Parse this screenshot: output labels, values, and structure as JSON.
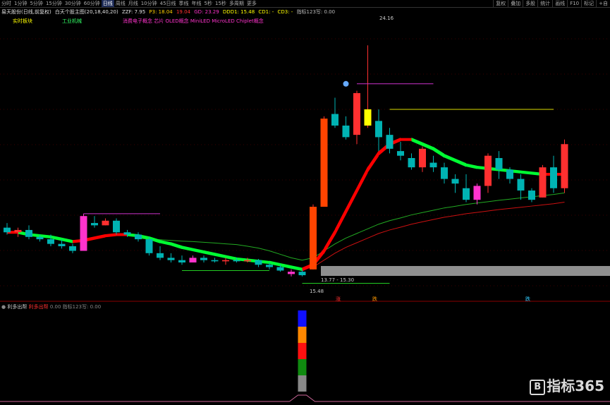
{
  "toolbar": {
    "tabs": [
      "分时",
      "1分钟",
      "5分钟",
      "15分钟",
      "30分钟",
      "60分钟",
      "日线",
      "周线",
      "月线",
      "10分钟",
      "45日线",
      "季线",
      "年线",
      "5秒",
      "15秒",
      "多周期",
      "更多"
    ],
    "active_tab": "日线",
    "right_buttons": [
      "复权",
      "叠加",
      "多股",
      "统计",
      "画线",
      "F10",
      "标记",
      "+自"
    ]
  },
  "info": {
    "stock": "易天股份(日线,前复权)",
    "indicator": "白天个股主图(20,18,40,20)",
    "zzf": "ZZF: 7.95",
    "p3": "P3: 18.04",
    "v1": "19.04",
    "gd": "GD: 23.29",
    "ddd1": "DDD1: 15.48",
    "cd1": "CD1: -",
    "cd3": "CD3: -",
    "zb": "指标123写: 0.00"
  },
  "labels": {
    "strong_sector": "实时板块",
    "industry": "工业机械",
    "concepts": "消费电子概念 芯片 OLED概念 MiniLED MicroLED Chiplet概念",
    "hi_price": "24.16",
    "lo_price": "15.48",
    "range": "13.77 - 15.30",
    "mk1": "涨",
    "mk2": "跌",
    "mk3": "跌"
  },
  "sub": {
    "title": "利多出帮",
    "name": "利多出帮",
    "v1": "0.00",
    "v2": "指标123写: 0.00"
  },
  "watermark": {
    "logo": "B",
    "text": "指标365"
  },
  "colors": {
    "up": "#ff3030",
    "down": "#00b3b3",
    "band_up": "#ff0000",
    "band_dn": "#00ff33",
    "magenta": "#ff33cc",
    "yellow": "#ffff00"
  },
  "chart_data": {
    "type": "candlestick",
    "candles": [
      {
        "o": 16.3,
        "h": 16.5,
        "l": 16.0,
        "c": 16.1
      },
      {
        "o": 16.1,
        "h": 16.3,
        "l": 15.9,
        "c": 16.2
      },
      {
        "o": 16.2,
        "h": 16.4,
        "l": 15.8,
        "c": 15.9
      },
      {
        "o": 15.9,
        "h": 16.0,
        "l": 15.7,
        "c": 15.8
      },
      {
        "o": 15.8,
        "h": 16.0,
        "l": 15.5,
        "c": 15.6
      },
      {
        "o": 15.6,
        "h": 15.8,
        "l": 15.4,
        "c": 15.5
      },
      {
        "o": 15.5,
        "h": 15.6,
        "l": 15.2,
        "c": 15.3
      },
      {
        "o": 15.3,
        "h": 16.9,
        "l": 15.3,
        "c": 16.8,
        "special": "m"
      },
      {
        "o": 16.5,
        "h": 16.8,
        "l": 16.3,
        "c": 16.4
      },
      {
        "o": 16.4,
        "h": 16.7,
        "l": 16.4,
        "c": 16.6
      },
      {
        "o": 16.6,
        "h": 16.7,
        "l": 16.0,
        "c": 16.1
      },
      {
        "o": 16.1,
        "h": 16.2,
        "l": 15.9,
        "c": 16.0
      },
      {
        "o": 16.0,
        "h": 16.1,
        "l": 15.7,
        "c": 15.8
      },
      {
        "o": 15.8,
        "h": 15.9,
        "l": 15.1,
        "c": 15.2
      },
      {
        "o": 15.2,
        "h": 15.5,
        "l": 14.9,
        "c": 15.0
      },
      {
        "o": 15.0,
        "h": 15.2,
        "l": 14.8,
        "c": 14.9
      },
      {
        "o": 14.9,
        "h": 15.1,
        "l": 14.7,
        "c": 14.8
      },
      {
        "o": 14.8,
        "h": 15.1,
        "l": 14.8,
        "c": 15.0,
        "special": "m"
      },
      {
        "o": 15.0,
        "h": 15.1,
        "l": 14.8,
        "c": 14.9
      },
      {
        "o": 14.9,
        "h": 15.0,
        "l": 14.8,
        "c": 14.85
      },
      {
        "o": 14.85,
        "h": 15.0,
        "l": 14.7,
        "c": 14.9
      },
      {
        "o": 14.9,
        "h": 15.0,
        "l": 14.8,
        "c": 14.85
      },
      {
        "o": 14.85,
        "h": 15.0,
        "l": 14.8,
        "c": 14.9
      },
      {
        "o": 14.9,
        "h": 14.95,
        "l": 14.6,
        "c": 14.7
      },
      {
        "o": 14.7,
        "h": 14.8,
        "l": 14.5,
        "c": 14.6
      },
      {
        "o": 14.6,
        "h": 14.7,
        "l": 14.4,
        "c": 14.45
      },
      {
        "o": 14.3,
        "h": 14.5,
        "l": 14.2,
        "c": 14.4,
        "special": "m"
      },
      {
        "o": 14.4,
        "h": 14.5,
        "l": 14.2,
        "c": 14.25
      },
      {
        "o": 14.5,
        "h": 17.3,
        "l": 14.5,
        "c": 17.2
      },
      {
        "o": 17.2,
        "h": 21.1,
        "l": 17.2,
        "c": 21.0
      },
      {
        "o": 21.2,
        "h": 21.9,
        "l": 20.6,
        "c": 20.7
      },
      {
        "o": 20.7,
        "h": 21.1,
        "l": 20.1,
        "c": 20.2
      },
      {
        "o": 20.3,
        "h": 22.2,
        "l": 19.9,
        "c": 22.1
      },
      {
        "o": 20.7,
        "h": 24.16,
        "l": 20.6,
        "c": 21.4,
        "special": "y"
      },
      {
        "o": 20.9,
        "h": 21.4,
        "l": 19.6,
        "c": 20.2
      },
      {
        "o": 20.3,
        "h": 20.6,
        "l": 19.5,
        "c": 19.7
      },
      {
        "o": 19.6,
        "h": 20.0,
        "l": 19.2,
        "c": 19.4
      },
      {
        "o": 19.3,
        "h": 19.5,
        "l": 18.8,
        "c": 18.9
      },
      {
        "o": 18.9,
        "h": 19.8,
        "l": 18.7,
        "c": 19.7
      },
      {
        "o": 19.1,
        "h": 19.4,
        "l": 18.7,
        "c": 18.9
      },
      {
        "o": 18.9,
        "h": 19.1,
        "l": 18.2,
        "c": 18.4
      },
      {
        "o": 18.4,
        "h": 18.6,
        "l": 17.8,
        "c": 18.2
      },
      {
        "o": 18.0,
        "h": 18.6,
        "l": 17.4,
        "c": 17.5
      },
      {
        "o": 17.5,
        "h": 18.2,
        "l": 17.3,
        "c": 18.1,
        "special": "m"
      },
      {
        "o": 18.1,
        "h": 19.5,
        "l": 17.8,
        "c": 19.4
      },
      {
        "o": 19.3,
        "h": 19.6,
        "l": 18.4,
        "c": 18.8
      },
      {
        "o": 18.8,
        "h": 18.9,
        "l": 18.2,
        "c": 18.4
      },
      {
        "o": 18.4,
        "h": 18.6,
        "l": 17.5,
        "c": 17.9
      },
      {
        "o": 17.9,
        "h": 18.0,
        "l": 17.4,
        "c": 17.5
      },
      {
        "o": 17.6,
        "h": 19.0,
        "l": 17.6,
        "c": 18.9
      },
      {
        "o": 18.9,
        "h": 19.4,
        "l": 17.8,
        "c": 18.0
      },
      {
        "o": 18.0,
        "h": 20.1,
        "l": 17.8,
        "c": 19.9
      }
    ],
    "band_ma": [
      16.1,
      16.1,
      16.0,
      15.95,
      15.9,
      15.8,
      15.7,
      15.75,
      15.85,
      15.95,
      16.0,
      16.0,
      15.95,
      15.85,
      15.7,
      15.6,
      15.45,
      15.35,
      15.25,
      15.15,
      15.05,
      14.95,
      14.9,
      14.85,
      14.8,
      14.7,
      14.6,
      14.5,
      14.7,
      15.3,
      16.1,
      17.0,
      17.9,
      18.8,
      19.5,
      19.9,
      20.1,
      20.1,
      19.9,
      19.7,
      19.4,
      19.2,
      19.0,
      18.9,
      18.85,
      18.8,
      18.75,
      18.7,
      18.65,
      18.6,
      18.6,
      18.6
    ],
    "long_ma": [
      null,
      null,
      null,
      null,
      null,
      null,
      null,
      null,
      null,
      null,
      null,
      null,
      15.85,
      15.8,
      15.78,
      15.75,
      15.72,
      15.7,
      15.67,
      15.64,
      15.6,
      15.57,
      15.5,
      15.42,
      15.3,
      15.15,
      15.0,
      14.9,
      15.0,
      15.3,
      15.6,
      15.85,
      16.05,
      16.25,
      16.45,
      16.6,
      16.72,
      16.85,
      16.95,
      17.05,
      17.15,
      17.22,
      17.3,
      17.36,
      17.42,
      17.48,
      17.53,
      17.58,
      17.63,
      17.68,
      17.73,
      17.8
    ],
    "sub_bars": [
      {
        "color": "#1010ff",
        "v": 1
      },
      {
        "color": "#ff8800",
        "v": 1
      },
      {
        "color": "#ff1010",
        "v": 1
      },
      {
        "color": "#108a10",
        "v": 1
      },
      {
        "color": "#888888",
        "v": 1
      }
    ]
  }
}
